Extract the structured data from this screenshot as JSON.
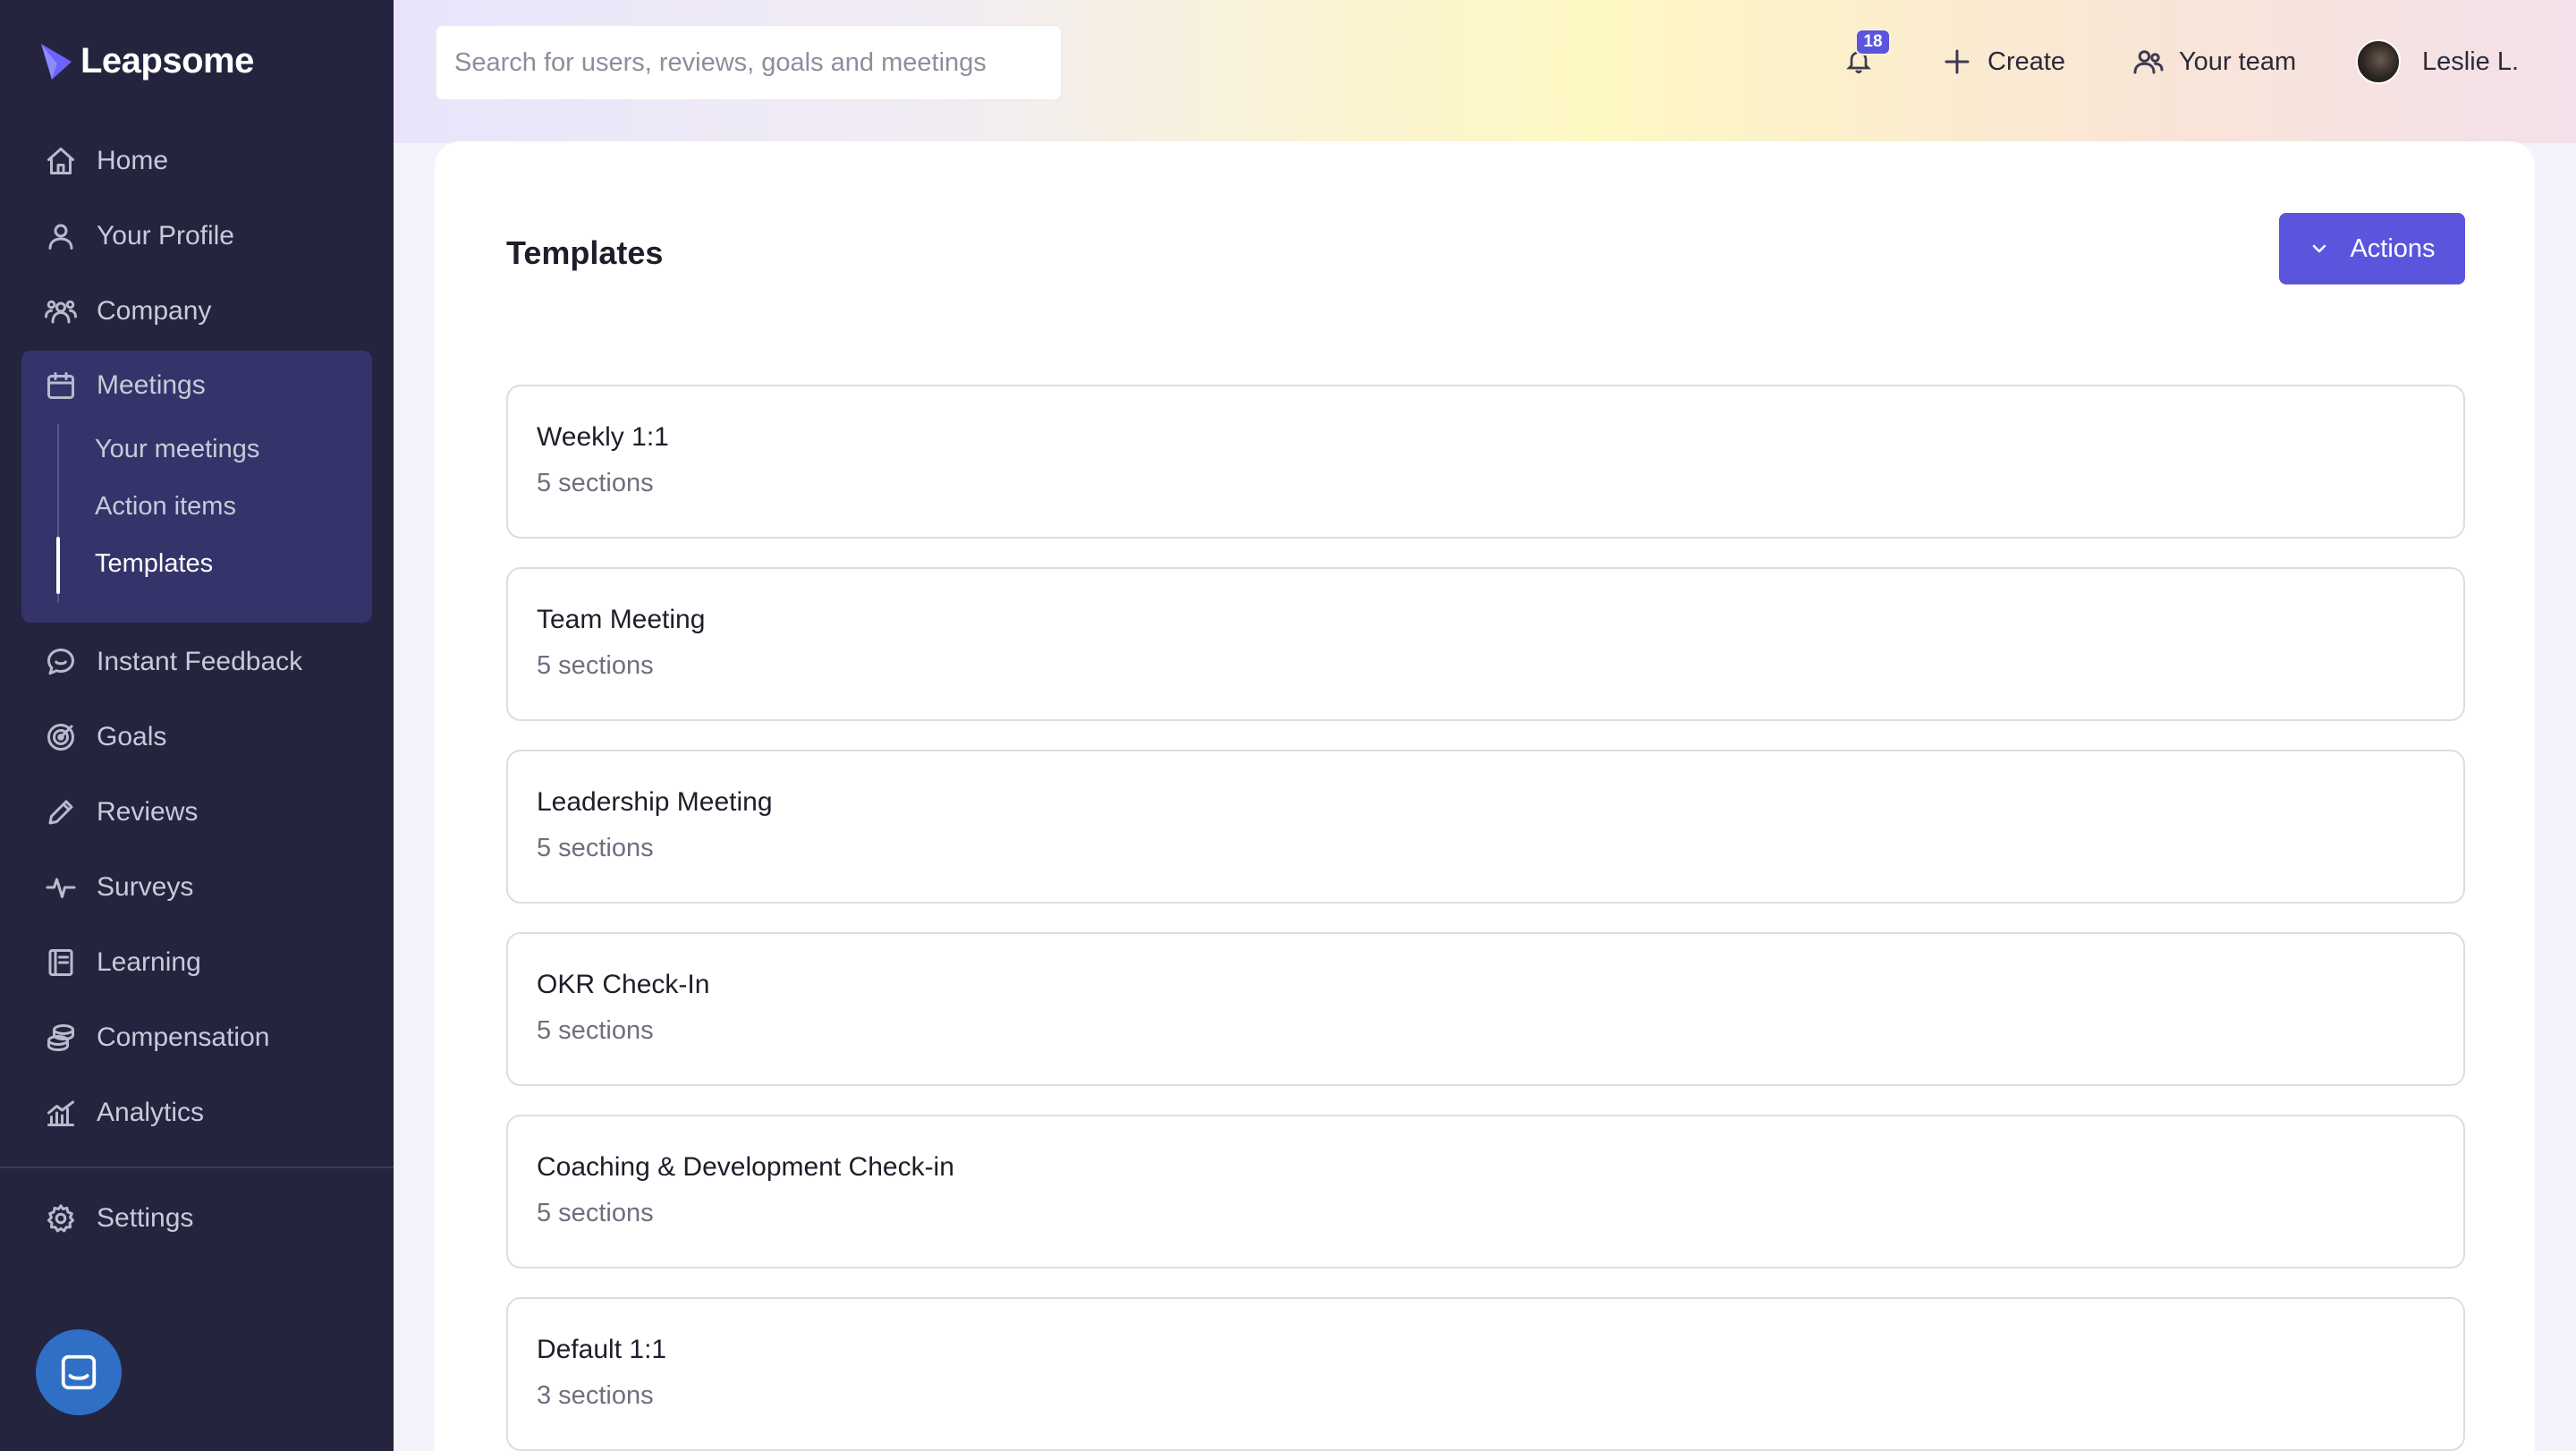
{
  "brand": {
    "name": "Leapsome"
  },
  "sidebar": {
    "items": [
      {
        "label": "Home"
      },
      {
        "label": "Your Profile"
      },
      {
        "label": "Company"
      },
      {
        "label": "Meetings"
      },
      {
        "label": "Instant Feedback"
      },
      {
        "label": "Goals"
      },
      {
        "label": "Reviews"
      },
      {
        "label": "Surveys"
      },
      {
        "label": "Learning"
      },
      {
        "label": "Compensation"
      },
      {
        "label": "Analytics"
      },
      {
        "label": "Settings"
      }
    ],
    "meetings_sub": [
      {
        "label": "Your meetings"
      },
      {
        "label": "Action items"
      },
      {
        "label": "Templates"
      }
    ]
  },
  "topbar": {
    "search_placeholder": "Search for users, reviews, goals and meetings",
    "notification_count": "18",
    "create_label": "Create",
    "team_label": "Your team",
    "user_name": "Leslie L."
  },
  "main": {
    "title": "Templates",
    "actions_label": "Actions",
    "templates": [
      {
        "name": "Weekly 1:1",
        "sections": "5 sections"
      },
      {
        "name": "Team Meeting",
        "sections": "5 sections"
      },
      {
        "name": "Leadership Meeting",
        "sections": "5 sections"
      },
      {
        "name": "OKR Check-In",
        "sections": "5 sections"
      },
      {
        "name": "Coaching & Development Check-in",
        "sections": "5 sections"
      },
      {
        "name": "Default 1:1",
        "sections": "3 sections"
      }
    ]
  },
  "colors": {
    "sidebar_bg": "#24243f",
    "sidebar_active_group": "#34346b",
    "accent": "#5b55dd",
    "chat_button": "#2f6fc5"
  }
}
